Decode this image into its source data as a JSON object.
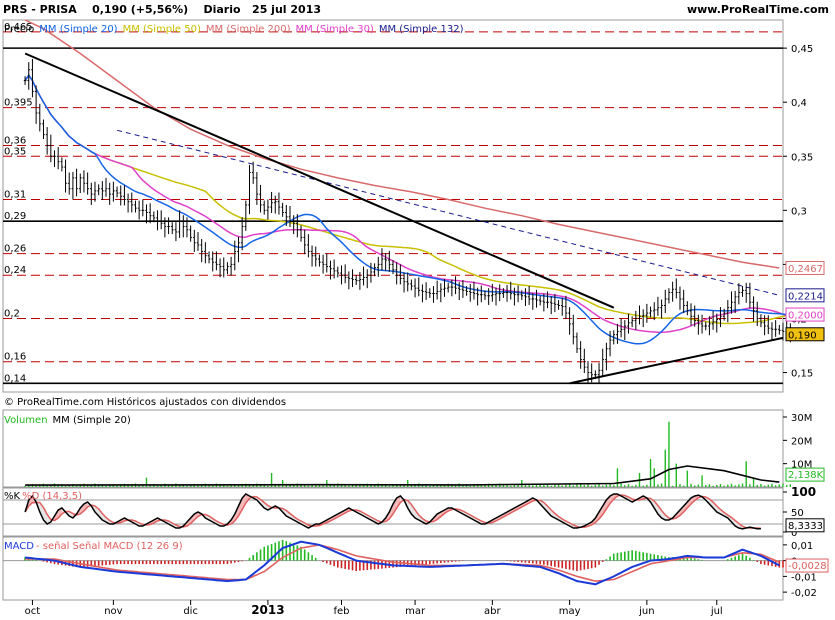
{
  "header": {
    "ticker": "PRS - PRISA",
    "last": "0,190 (+5,56%)",
    "period": "Diario",
    "date": "25 jul 2013",
    "site": "www.ProRealTime.com"
  },
  "footer_note": "© ProRealTime.com Históricos ajustados con dividendos",
  "colors": {
    "ma20": "#1565e8",
    "ma50": "#c8c000",
    "ma200": "#d96a6a",
    "ma30": "#e040c8",
    "ma132": "#1a1a8c",
    "hline_red": "#c00000",
    "candle": "#000000",
    "vol": "#22b822",
    "stoch_k": "#000000",
    "stoch_d": "#e06060",
    "macd": "#1a3ad8",
    "signal": "#e06060",
    "hist_pos": "#22b822",
    "hist_neg": "#cc2222",
    "last_bg": "#f0c010"
  },
  "chart_data": [
    {
      "type": "candlestick",
      "panel": "price",
      "legend": [
        {
          "text": "Precio",
          "color": "#000000"
        },
        {
          "text": "MM (Simple 20)",
          "color": "#1565e8"
        },
        {
          "text": "MM (Simple 50)",
          "color": "#c8c000"
        },
        {
          "text": "MM (Simple 200)",
          "color": "#d96a6a"
        },
        {
          "text": "MM (Simple 30)",
          "color": "#e040c8"
        },
        {
          "text": "MM (Simple 132)",
          "color": "#1a1a8c"
        }
      ],
      "y_axis_ticks": [
        "0,45",
        "0,4",
        "0,35",
        "0,3",
        "0,25",
        "0,2",
        "0,15"
      ],
      "y_axis_tick_values": [
        0.45,
        0.4,
        0.35,
        0.3,
        0.25,
        0.2,
        0.15
      ],
      "left_level_labels": [
        "0,465",
        "0,395",
        "0,36",
        "0,35",
        "0,31",
        "0,29",
        "0,26",
        "0,24",
        "0,2",
        "0,16",
        "0,14"
      ],
      "left_level_values": [
        0.465,
        0.395,
        0.36,
        0.35,
        0.31,
        0.29,
        0.26,
        0.24,
        0.2,
        0.16,
        0.14
      ],
      "black_levels": [
        0.45,
        0.29,
        0.14
      ],
      "ylim": [
        0.132,
        0.476
      ],
      "x_ticks": [
        "oct",
        "nov",
        "dic",
        "2013",
        "feb",
        "mar",
        "abr",
        "may",
        "jun",
        "jul"
      ],
      "x_tick_positions": [
        2,
        24,
        45,
        66,
        86,
        106,
        127,
        148,
        169,
        188
      ],
      "x_range": [
        -6,
        206
      ],
      "price_close": [
        0.42,
        0.43,
        0.41,
        0.39,
        0.38,
        0.37,
        0.36,
        0.35,
        0.35,
        0.345,
        0.34,
        0.325,
        0.32,
        0.33,
        0.32,
        0.33,
        0.325,
        0.32,
        0.315,
        0.318,
        0.32,
        0.318,
        0.32,
        0.315,
        0.318,
        0.316,
        0.313,
        0.31,
        0.308,
        0.305,
        0.302,
        0.3,
        0.3,
        0.298,
        0.295,
        0.293,
        0.29,
        0.288,
        0.285,
        0.285,
        0.282,
        0.28,
        0.29,
        0.285,
        0.282,
        0.275,
        0.27,
        0.268,
        0.262,
        0.258,
        0.255,
        0.252,
        0.25,
        0.248,
        0.245,
        0.248,
        0.25,
        0.262,
        0.27,
        0.285,
        0.305,
        0.335,
        0.33,
        0.315,
        0.305,
        0.3,
        0.303,
        0.307,
        0.308,
        0.303,
        0.298,
        0.294,
        0.29,
        0.288,
        0.282,
        0.275,
        0.268,
        0.262,
        0.258,
        0.255,
        0.252,
        0.25,
        0.248,
        0.246,
        0.244,
        0.242,
        0.24,
        0.238,
        0.237,
        0.236,
        0.235,
        0.236,
        0.238,
        0.24,
        0.243,
        0.247,
        0.25,
        0.255,
        0.254,
        0.25,
        0.245,
        0.24,
        0.237,
        0.234,
        0.232,
        0.23,
        0.228,
        0.226,
        0.225,
        0.224,
        0.223,
        0.223,
        0.225,
        0.227,
        0.228,
        0.229,
        0.229,
        0.228,
        0.227,
        0.226,
        0.225,
        0.224,
        0.223,
        0.222,
        0.222,
        0.221,
        0.221,
        0.222,
        0.223,
        0.223,
        0.224,
        0.224,
        0.223,
        0.222,
        0.222,
        0.221,
        0.22,
        0.218,
        0.218,
        0.217,
        0.216,
        0.215,
        0.215,
        0.214,
        0.213,
        0.212,
        0.211,
        0.205,
        0.195,
        0.183,
        0.172,
        0.162,
        0.155,
        0.15,
        0.148,
        0.148,
        0.152,
        0.162,
        0.172,
        0.18,
        0.185,
        0.188,
        0.19,
        0.193,
        0.196,
        0.198,
        0.2,
        0.202,
        0.203,
        0.205,
        0.207,
        0.208,
        0.21,
        0.212,
        0.218,
        0.224,
        0.227,
        0.224,
        0.218,
        0.212,
        0.207,
        0.202,
        0.198,
        0.195,
        0.193,
        0.193,
        0.195,
        0.197,
        0.199,
        0.202,
        0.205,
        0.21,
        0.215,
        0.22,
        0.224,
        0.226,
        0.223,
        0.215,
        0.207,
        0.2,
        0.196,
        0.193,
        0.191,
        0.19,
        0.19,
        0.189,
        0.188,
        0.188,
        0.19
      ],
      "series": [
        {
          "name": "MM (Simple 200)",
          "last_label": "0,2467",
          "x": [
            0,
            5,
            15,
            25,
            35,
            45,
            55,
            65,
            75,
            85,
            95,
            105,
            115,
            125,
            135,
            145,
            155,
            165,
            175,
            185,
            195,
            205
          ],
          "y": [
            0.476,
            0.468,
            0.445,
            0.42,
            0.395,
            0.375,
            0.36,
            0.348,
            0.338,
            0.33,
            0.323,
            0.317,
            0.31,
            0.302,
            0.295,
            0.287,
            0.28,
            0.273,
            0.266,
            0.259,
            0.252,
            0.2467
          ]
        },
        {
          "name": "MM (Simple 132)",
          "last_label": "0,2214",
          "x": [
            25,
            205
          ],
          "y": [
            0.374,
            0.2214
          ]
        },
        {
          "name": "MM (Simple 30)",
          "last_label": "0,2000"
        },
        {
          "name": "MM (Simple 50)",
          "last_label": "0,190"
        },
        {
          "name": "MM (Simple 20)"
        }
      ],
      "last_price_label": "0,190",
      "trendlines": [
        {
          "x": [
            0,
            160
          ],
          "y": [
            0.445,
            0.21
          ]
        },
        {
          "x": [
            148,
            206
          ],
          "y": [
            0.14,
            0.182
          ]
        }
      ]
    },
    {
      "type": "bar",
      "panel": "volume",
      "legend": [
        {
          "text": "Volumen",
          "color": "#22b822"
        },
        {
          "text": "MM (Simple 20)",
          "color": "#000000"
        }
      ],
      "y_axis_ticks": [
        "30M",
        "20M",
        "10M"
      ],
      "y_axis_tick_values": [
        30,
        20,
        10
      ],
      "ylim": [
        0,
        33
      ],
      "last_label": "2,138K",
      "spikes": [
        {
          "x": 33,
          "v": 4
        },
        {
          "x": 67,
          "v": 6
        },
        {
          "x": 70,
          "v": 3
        },
        {
          "x": 82,
          "v": 3
        },
        {
          "x": 104,
          "v": 3
        },
        {
          "x": 135,
          "v": 3
        },
        {
          "x": 161,
          "v": 8
        },
        {
          "x": 167,
          "v": 6
        },
        {
          "x": 170,
          "v": 12
        },
        {
          "x": 171,
          "v": 8
        },
        {
          "x": 174,
          "v": 16
        },
        {
          "x": 175,
          "v": 28
        },
        {
          "x": 177,
          "v": 10
        },
        {
          "x": 180,
          "v": 7
        },
        {
          "x": 184,
          "v": 5
        },
        {
          "x": 196,
          "v": 11
        },
        {
          "x": 198,
          "v": 4
        }
      ],
      "ma_series": {
        "x": [
          0,
          40,
          80,
          120,
          160,
          170,
          175,
          180,
          190,
          200,
          205
        ],
        "y": [
          0.8,
          0.9,
          1.0,
          0.9,
          1.5,
          3.5,
          7.5,
          9.0,
          7.0,
          3.0,
          2.1
        ]
      }
    },
    {
      "type": "line",
      "panel": "stochastic",
      "legend": [
        {
          "text": "%K",
          "color": "#000000"
        },
        {
          "text": "%D (14,3,5)",
          "color": "#e06060"
        }
      ],
      "y_axis_ticks": [
        "100",
        "50",
        "0"
      ],
      "y_axis_tick_values": [
        100,
        50,
        0
      ],
      "ylim": [
        -10,
        110
      ],
      "bands": [
        20,
        80
      ],
      "last_label": "8,3333",
      "k": [
        50,
        80,
        90,
        75,
        50,
        30,
        20,
        25,
        40,
        55,
        60,
        50,
        40,
        35,
        45,
        60,
        70,
        75,
        65,
        50,
        40,
        30,
        25,
        20,
        20,
        25,
        30,
        35,
        30,
        25,
        20,
        15,
        15,
        20,
        25,
        30,
        35,
        30,
        25,
        20,
        15,
        10,
        10,
        15,
        25,
        35,
        45,
        50,
        45,
        35,
        30,
        25,
        20,
        15,
        15,
        20,
        30,
        45,
        65,
        85,
        95,
        90,
        85,
        80,
        70,
        60,
        55,
        60,
        65,
        60,
        50,
        40,
        35,
        30,
        25,
        20,
        15,
        10,
        15,
        20,
        20,
        25,
        30,
        35,
        40,
        45,
        50,
        55,
        60,
        55,
        50,
        45,
        40,
        35,
        30,
        25,
        20,
        25,
        35,
        50,
        70,
        85,
        90,
        80,
        60,
        45,
        35,
        30,
        25,
        20,
        25,
        35,
        45,
        50,
        55,
        60,
        60,
        55,
        50,
        45,
        40,
        35,
        30,
        25,
        20,
        20,
        25,
        30,
        35,
        40,
        45,
        50,
        55,
        60,
        65,
        70,
        75,
        80,
        85,
        80,
        70,
        60,
        50,
        40,
        35,
        30,
        25,
        20,
        15,
        10,
        10,
        12,
        15,
        20,
        25,
        35,
        50,
        65,
        80,
        90,
        95,
        95,
        90,
        85,
        80,
        75,
        80,
        85,
        90,
        85,
        75,
        60,
        45,
        35,
        30,
        30,
        35,
        45,
        55,
        65,
        75,
        85,
        90,
        92,
        88,
        80,
        70,
        60,
        50,
        45,
        40,
        35,
        25,
        15,
        10,
        8,
        10,
        12,
        10,
        8,
        8
      ]
    },
    {
      "type": "line",
      "panel": "macd",
      "legend": [
        {
          "text": "MACD",
          "color": "#1a3ad8"
        },
        {
          "text": "- señal Señal MACD (12 26 9)",
          "color": "#e06060"
        }
      ],
      "y_axis_ticks": [
        "0,01",
        "0",
        "-0,01",
        "-0,02"
      ],
      "y_axis_tick_values": [
        0.01,
        0,
        -0.01,
        -0.02
      ],
      "ylim": [
        -0.025,
        0.015
      ],
      "last_label": "-0,0028",
      "macd": {
        "x": [
          0,
          8,
          15,
          25,
          35,
          45,
          55,
          60,
          65,
          70,
          75,
          80,
          85,
          90,
          100,
          110,
          120,
          130,
          140,
          145,
          150,
          155,
          160,
          165,
          170,
          175,
          180,
          185,
          190,
          195,
          200,
          205
        ],
        "y": [
          0.002,
          0.0,
          -0.004,
          -0.007,
          -0.009,
          -0.011,
          -0.013,
          -0.012,
          -0.003,
          0.008,
          0.012,
          0.01,
          0.005,
          0.0,
          -0.003,
          -0.004,
          -0.003,
          -0.002,
          -0.004,
          -0.008,
          -0.013,
          -0.015,
          -0.01,
          -0.004,
          0.0,
          0.001,
          0.003,
          0.002,
          0.002,
          0.007,
          0.003,
          -0.003
        ]
      },
      "signal": {
        "x": [
          0,
          8,
          15,
          25,
          35,
          45,
          55,
          60,
          65,
          70,
          75,
          80,
          85,
          90,
          100,
          110,
          120,
          130,
          140,
          145,
          150,
          155,
          160,
          165,
          170,
          175,
          180,
          185,
          190,
          195,
          200,
          205
        ],
        "y": [
          0.001,
          0.001,
          -0.002,
          -0.006,
          -0.008,
          -0.01,
          -0.012,
          -0.012,
          -0.007,
          0.002,
          0.008,
          0.01,
          0.007,
          0.003,
          -0.001,
          -0.003,
          -0.003,
          -0.002,
          -0.003,
          -0.006,
          -0.01,
          -0.013,
          -0.012,
          -0.007,
          -0.002,
          0.0,
          0.002,
          0.002,
          0.002,
          0.005,
          0.004,
          -0.001
        ]
      }
    }
  ]
}
